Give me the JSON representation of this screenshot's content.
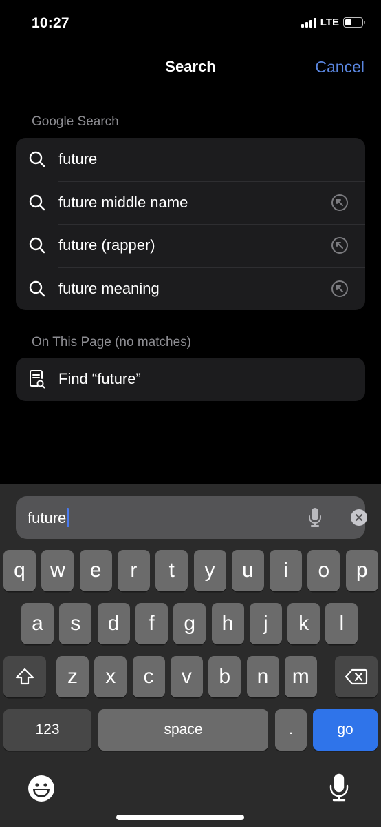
{
  "status_bar": {
    "time": "10:27",
    "network": "LTE",
    "battery_level": 0.4
  },
  "nav": {
    "title": "Search",
    "cancel_label": "Cancel",
    "accent_color": "#5a86e0"
  },
  "google_search": {
    "section_label": "Google Search",
    "suggestions": [
      {
        "label": "future",
        "icon": "search-icon",
        "has_fill_arrow": false
      },
      {
        "label": "future middle name",
        "icon": "search-icon",
        "has_fill_arrow": true
      },
      {
        "label": "future (rapper)",
        "icon": "search-icon",
        "has_fill_arrow": true
      },
      {
        "label": "future meaning",
        "icon": "search-icon",
        "has_fill_arrow": true
      }
    ]
  },
  "on_this_page": {
    "section_label": "On This Page (no matches)",
    "find_label": "Find “future”",
    "icon": "find-in-page-icon"
  },
  "search_field": {
    "value": "future"
  },
  "keyboard": {
    "row1": [
      "q",
      "w",
      "e",
      "r",
      "t",
      "y",
      "u",
      "i",
      "o",
      "p"
    ],
    "row2": [
      "a",
      "s",
      "d",
      "f",
      "g",
      "h",
      "j",
      "k",
      "l"
    ],
    "row3": [
      "z",
      "x",
      "c",
      "v",
      "b",
      "n",
      "m"
    ],
    "numbers_label": "123",
    "space_label": "space",
    "period_label": ".",
    "go_label": "go",
    "go_color": "#2f74ea"
  }
}
